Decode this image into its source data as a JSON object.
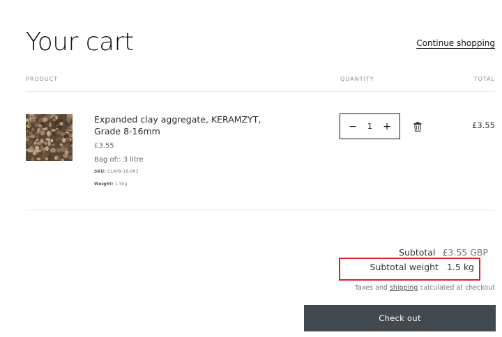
{
  "page": {
    "title": "Your cart",
    "continue_label": "Continue shopping"
  },
  "columns": {
    "product": "PRODUCT",
    "quantity": "QUANTITY",
    "total": "TOTAL"
  },
  "item": {
    "name": "Expanded clay aggregate, KERAMZYT, Grade 8-16mm",
    "price": "£3.55",
    "option": "Bag of:: 3 litre",
    "sku_label": "SKU:",
    "sku_value": "CLAY8-16-003",
    "weight_label": "Weight:",
    "weight_value": "1.5kg",
    "quantity": "1",
    "minus_label": "−",
    "plus_label": "+",
    "line_total": "£3.55"
  },
  "summary": {
    "subtotal_label": "Subtotal",
    "subtotal_value": "£3.55 GBP",
    "weight_label": "Subtotal weight",
    "weight_value": "1.5 kg",
    "taxes_before": "Taxes and ",
    "taxes_link": "shipping",
    "taxes_after": " calculated at checkout",
    "checkout_label": "Check out"
  },
  "colors": {
    "highlight": "#e01b24",
    "checkout_bg": "#434a4f"
  },
  "icons": {
    "delete": "trash-icon",
    "product_image": "clay-pebbles-image"
  }
}
